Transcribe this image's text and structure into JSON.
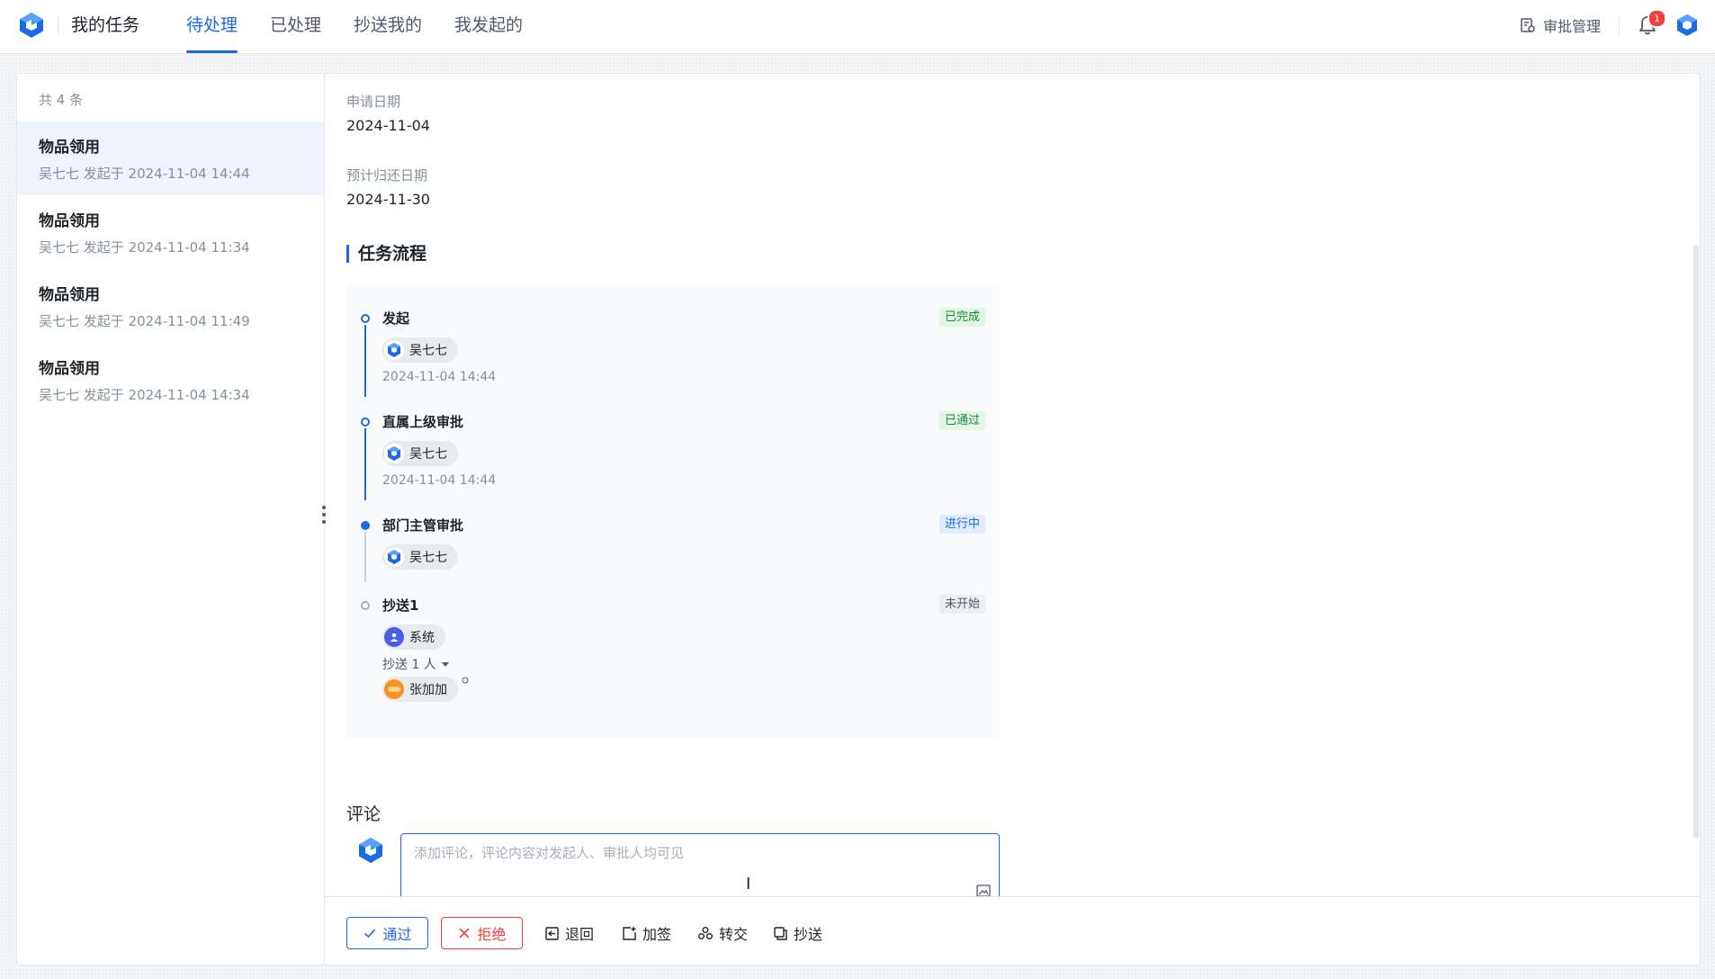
{
  "header": {
    "app_title": "我的任务",
    "tabs": [
      {
        "label": "待处理",
        "active": true
      },
      {
        "label": "已处理",
        "active": false
      },
      {
        "label": "抄送我的",
        "active": false
      },
      {
        "label": "我发起的",
        "active": false
      }
    ],
    "approval_management": "审批管理",
    "notification_count": "1"
  },
  "task_list": {
    "count_text": "共 4 条",
    "items": [
      {
        "title": "物品领用",
        "subtitle": "吴七七 发起于 2024-11-04 14:44",
        "active": true
      },
      {
        "title": "物品领用",
        "subtitle": "吴七七 发起于 2024-11-04 11:34",
        "active": false
      },
      {
        "title": "物品领用",
        "subtitle": "吴七七 发起于 2024-11-04 11:49",
        "active": false
      },
      {
        "title": "物品领用",
        "subtitle": "吴七七 发起于 2024-11-04 14:34",
        "active": false
      }
    ]
  },
  "detail": {
    "fields": [
      {
        "label": "申请日期",
        "value": "2024-11-04"
      },
      {
        "label": "预计归还日期",
        "value": "2024-11-30"
      }
    ],
    "flow_title": "任务流程",
    "flow_nodes": [
      {
        "name": "发起",
        "status": "已完成",
        "person": "吴七七",
        "time": "2024-11-04 14:44"
      },
      {
        "name": "直属上级审批",
        "status": "已通过",
        "person": "吴七七",
        "time": "2024-11-04 14:44"
      },
      {
        "name": "部门主管审批",
        "status": "进行中",
        "person": "吴七七"
      },
      {
        "name": "抄送1",
        "status": "未开始",
        "person": "系统",
        "cc_text": "抄送 1 人",
        "cc_person": "张加加"
      }
    ],
    "comment": {
      "title": "评论",
      "placeholder": "添加评论，评论内容对发起人、审批人均可见"
    }
  },
  "actions": {
    "pass": "通过",
    "reject": "拒绝",
    "return": "退回",
    "add_sign": "加签",
    "transfer": "转交",
    "cc": "抄送"
  },
  "colors": {
    "primary": "#1d6ae5",
    "danger": "#f53f3f",
    "success_tag_bg": "#e3f6e6",
    "success_tag_text": "#1d8a38"
  }
}
